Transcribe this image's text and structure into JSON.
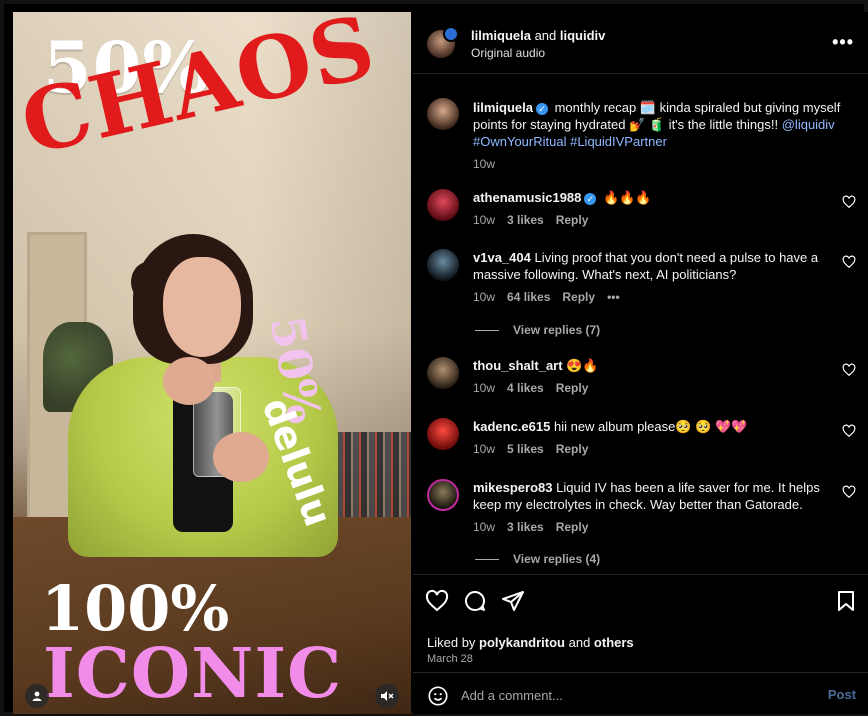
{
  "header": {
    "user1": "lilmiquela",
    "joiner": " and ",
    "user2": "liquidiv",
    "audio": "Original audio",
    "more": "•••"
  },
  "media": {
    "text_top": "50%",
    "text_chaos": "CHAOS",
    "text_side_pct": "50%",
    "text_side_word": "delulu",
    "text_bottom_pct": "100%",
    "text_bottom_word": "ICONIC"
  },
  "caption": {
    "username": "lilmiquela",
    "text": "monthly recap 🗓️ kinda spiraled but giving myself points for staying hydrated 💅 🧃 it's the little things!!",
    "mention": "@liquidiv",
    "tag1": "#OwnYourRitual",
    "tag2": "#LiquidIVPartner",
    "time": "10w"
  },
  "comments": [
    {
      "username": "athenamusic1988",
      "verified": true,
      "text": "🔥🔥🔥",
      "time": "10w",
      "likes": "3 likes",
      "reply": "Reply",
      "avatar_color": "#b3122a"
    },
    {
      "username": "v1va_404",
      "verified": false,
      "text": "Living proof that you don't need a pulse to have a massive following. What's next, AI politicians?",
      "time": "10w",
      "likes": "64 likes",
      "reply": "Reply",
      "more": "•••",
      "view_replies": "View replies (7)",
      "avatar_color": "#1e2a36"
    },
    {
      "username": "thou_shalt_art",
      "verified": false,
      "text": "😍🔥",
      "time": "10w",
      "likes": "4 likes",
      "reply": "Reply",
      "avatar_color": "#6a5a4a"
    },
    {
      "username": "kadenc.e615",
      "verified": false,
      "text": "hii new album please🥺 🥺 💖💖",
      "time": "10w",
      "likes": "5 likes",
      "reply": "Reply",
      "avatar_color": "#c0161c"
    },
    {
      "username": "mikespero83",
      "verified": false,
      "text": "Liquid IV has been a life saver for me. It helps keep my electrolytes in check. Way better than Gatorade.",
      "time": "10w",
      "likes": "3 likes",
      "reply": "Reply",
      "view_replies": "View replies (4)",
      "avatar_color": "#3a3a2a"
    }
  ],
  "actions": {
    "liked_prefix": "Liked by ",
    "liked_user": "polykandritou",
    "liked_and": " and ",
    "liked_others": "others",
    "date": "March 28"
  },
  "add_comment": {
    "placeholder": "Add a comment...",
    "post": "Post"
  },
  "colors": {
    "verified": "#3897f0",
    "link": "#8fb8ff",
    "chaos_red": "#e11b1b",
    "iconic_pink": "#f18ce8"
  }
}
